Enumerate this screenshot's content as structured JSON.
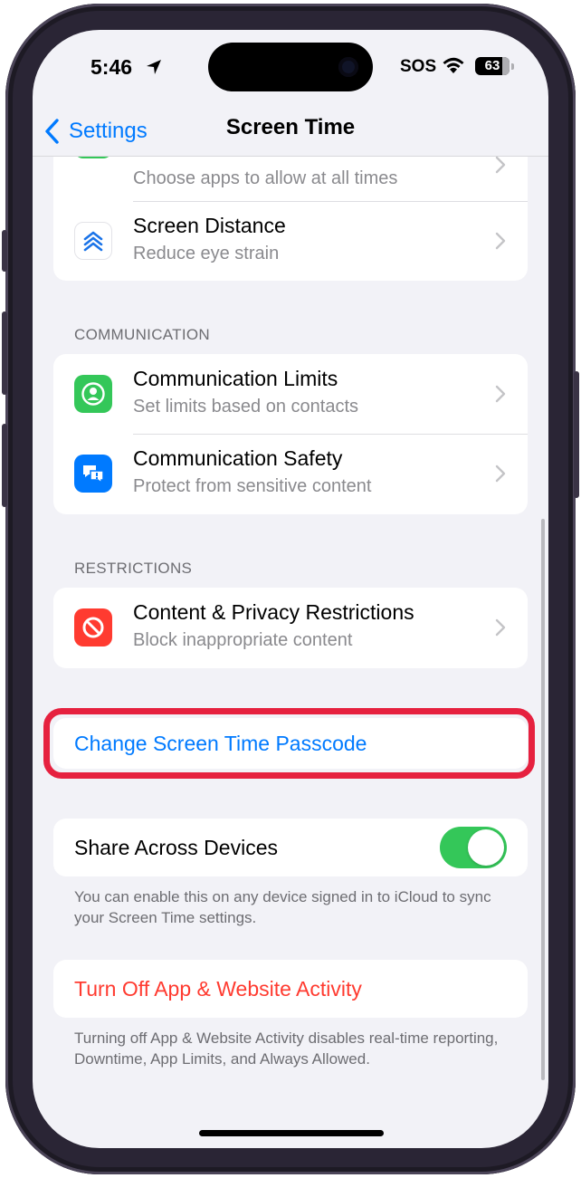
{
  "status_bar": {
    "time": "5:46",
    "carrier": "SOS",
    "battery": "63"
  },
  "nav": {
    "back_label": "Settings",
    "title": "Screen Time"
  },
  "top_group": [
    {
      "title": "",
      "subtitle": "Choose apps to allow at all times",
      "icon": "always-allowed-icon",
      "color": "#34c759"
    },
    {
      "title": "Screen Distance",
      "subtitle": "Reduce eye strain",
      "icon": "screen-distance-icon",
      "color": "#ffffff"
    }
  ],
  "communication": {
    "header": "COMMUNICATION",
    "items": [
      {
        "title": "Communication Limits",
        "subtitle": "Set limits based on contacts",
        "icon": "person-circle-icon",
        "color": "#34c759"
      },
      {
        "title": "Communication Safety",
        "subtitle": "Protect from sensitive content",
        "icon": "chat-bubble-icon",
        "color": "#007aff"
      }
    ]
  },
  "restrictions": {
    "header": "RESTRICTIONS",
    "items": [
      {
        "title": "Content & Privacy Restrictions",
        "subtitle": "Block inappropriate content",
        "icon": "prohibited-icon",
        "color": "#ff3b30"
      }
    ]
  },
  "passcode": {
    "label": "Change Screen Time Passcode",
    "highlight_color": "#e6213f"
  },
  "share": {
    "label": "Share Across Devices",
    "enabled": true,
    "note": "You can enable this on any device signed in to iCloud to sync your Screen Time settings."
  },
  "activity": {
    "label": "Turn Off App & Website Activity",
    "note": "Turning off App & Website Activity disables real-time reporting, Downtime, App Limits, and Always Allowed."
  },
  "colors": {
    "accent": "#007aff",
    "destructive": "#ff3b30",
    "toggle_on": "#34c759"
  }
}
